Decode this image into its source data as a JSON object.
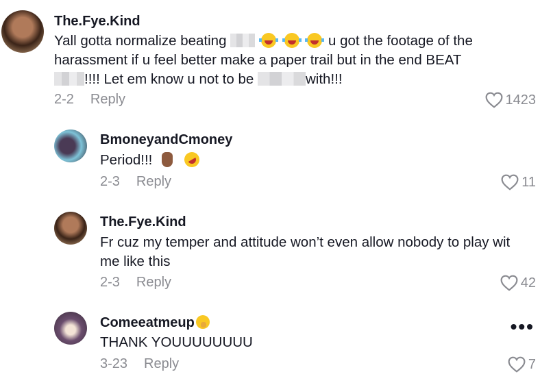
{
  "comments": [
    {
      "username": "The.Fye.Kind",
      "text_parts": [
        "Yall gotta normalize beating",
        "u got the footage of the",
        "harassment if u feel better make a paper trail but in the end BEAT",
        "!!!! Let em know u not to be",
        "with!!!"
      ],
      "date": "2-2",
      "reply": "Reply",
      "likes": "1423"
    },
    {
      "username": "BmoneyandCmoney",
      "text": "Period!!!",
      "date": "2-3",
      "reply": "Reply",
      "likes": "11"
    },
    {
      "username": "The.Fye.Kind",
      "text": "Fr cuz my temper and attitude won’t even allow nobody to play wit me like this",
      "date": "2-3",
      "reply": "Reply",
      "likes": "42"
    },
    {
      "username": "Comeeatmeup",
      "text": "THANK YOUUUUUUUU",
      "date": "3-23",
      "reply": "Reply",
      "likes": "7"
    }
  ],
  "icons": {
    "like": "heart-outline-icon",
    "more": "more-options-icon"
  },
  "colors": {
    "text": "#161823",
    "meta": "#8a8b91"
  }
}
